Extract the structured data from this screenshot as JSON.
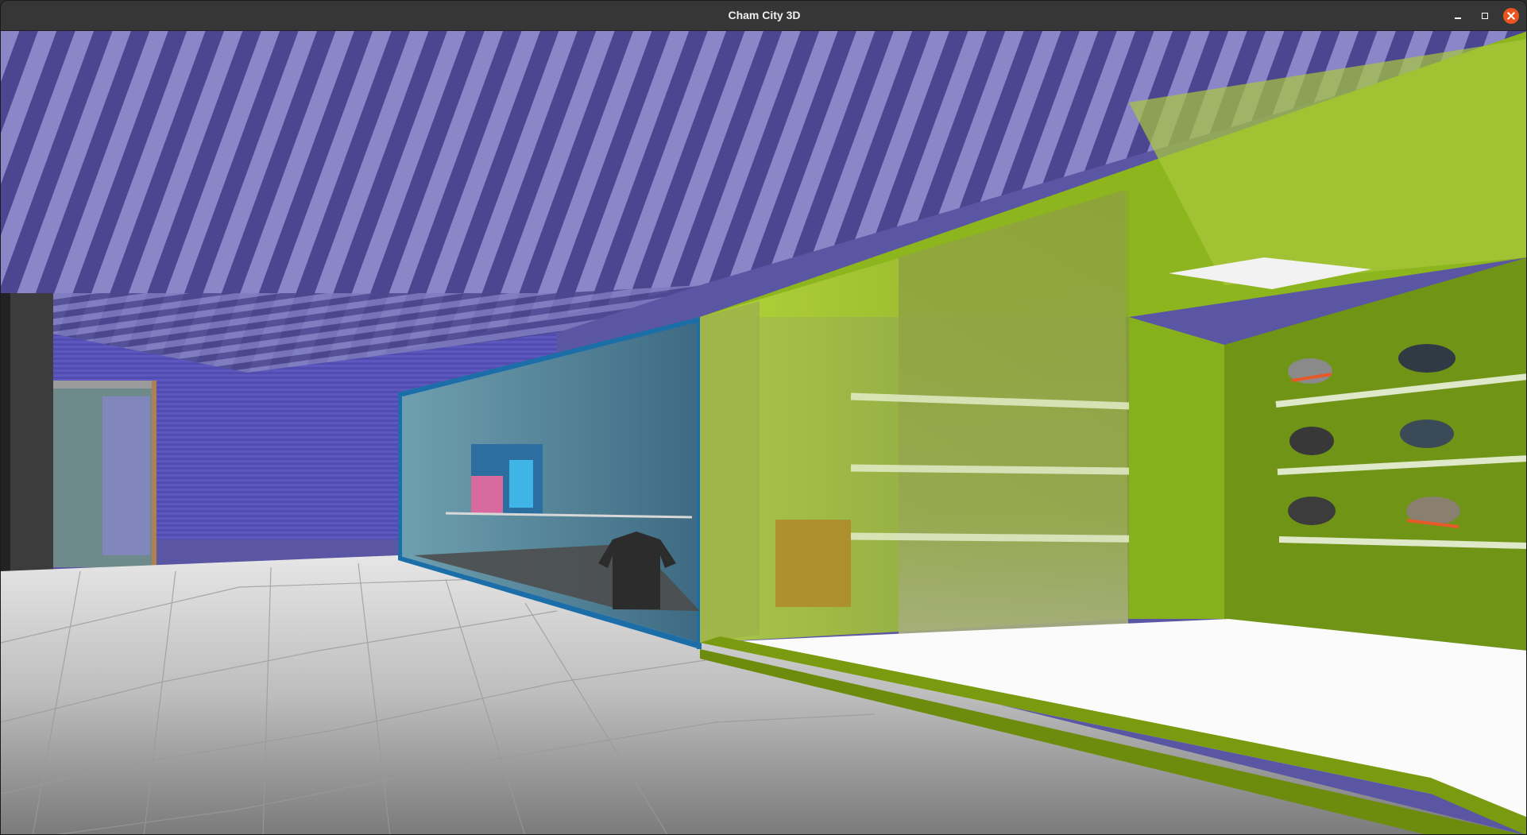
{
  "window": {
    "title": "Cham City 3D"
  },
  "window_controls": {
    "minimize_icon": "minimize-icon",
    "maximize_icon": "maximize-icon",
    "close_icon": "close-icon"
  },
  "scene": {
    "description_icons": [
      "ceiling",
      "floor",
      "storefront",
      "shoe-shelf",
      "t-shirt",
      "poster"
    ],
    "colors": {
      "ceiling_stripe_light": "#8a87c9",
      "ceiling_stripe_dark": "#4a4690",
      "back_wall": "#5450b8",
      "floor_light": "#d8d8d8",
      "floor_dark": "#8a8a8a",
      "shop_green": "#8db51e",
      "shop_green_dark": "#5c7a12",
      "shop_blue_frame": "#1c6ea8",
      "glass_tint": "#a8c83c"
    }
  }
}
